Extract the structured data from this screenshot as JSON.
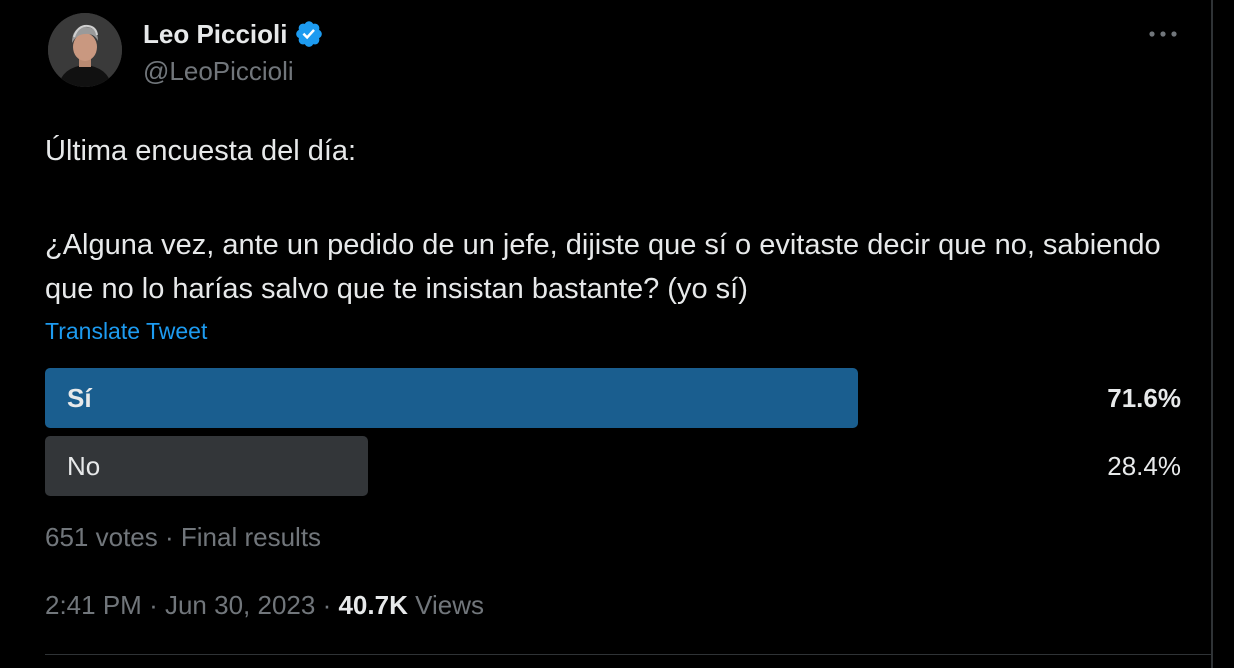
{
  "author": {
    "display_name": "Leo Piccioli",
    "handle": "@LeoPiccioli",
    "verified": true
  },
  "tweet": {
    "intro": "Última encuesta del día:",
    "question": "¿Alguna vez, ante un pedido de un jefe, dijiste que sí o evitaste decir que no, sabiendo que no lo harías salvo que te insistan bastante? (yo sí)",
    "translate_label": "Translate Tweet"
  },
  "poll": {
    "options": [
      {
        "label": "Sí",
        "percent_text": "71.6%",
        "percent": 71.6,
        "winner": true
      },
      {
        "label": "No",
        "percent_text": "28.4%",
        "percent": 28.4,
        "winner": false
      }
    ],
    "votes": "651 votes",
    "separator": "·",
    "status": "Final results"
  },
  "meta": {
    "time": "2:41 PM",
    "separator": "·",
    "date": "Jun 30, 2023",
    "views_count": "40.7K",
    "views_label": "Views"
  },
  "colors": {
    "background": "#000000",
    "text": "#e7e9ea",
    "muted": "#71767b",
    "link": "#1d9bf0",
    "verified": "#1d9bf0",
    "winner_bar": "#1a5e8f",
    "loser_bar": "#333639"
  },
  "icons": {
    "verified": "verified-badge-icon",
    "more": "more-options-icon",
    "avatar": "profile-avatar"
  }
}
